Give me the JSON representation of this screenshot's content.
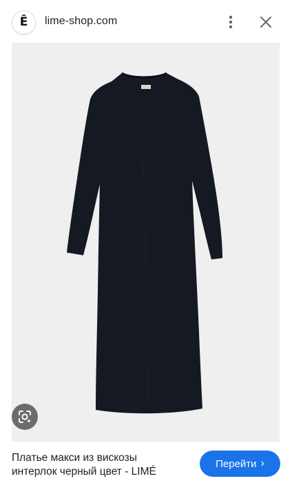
{
  "header": {
    "site_logo_letter": "Ē",
    "site_domain": "lime-shop.com",
    "more_icon": "more-vert-icon",
    "close_icon": "close-icon"
  },
  "image": {
    "description_icon": "product-photo",
    "background_color": "#efefef",
    "garment_color": "#141922"
  },
  "lens": {
    "icon": "google-lens-icon"
  },
  "caption": {
    "line1": "Платье макси из вискозы",
    "line2": "интерлок черный цвет - LIMÉ"
  },
  "visit_button": {
    "label": "Перейти",
    "chevron": "›",
    "color": "#1a73e8"
  }
}
